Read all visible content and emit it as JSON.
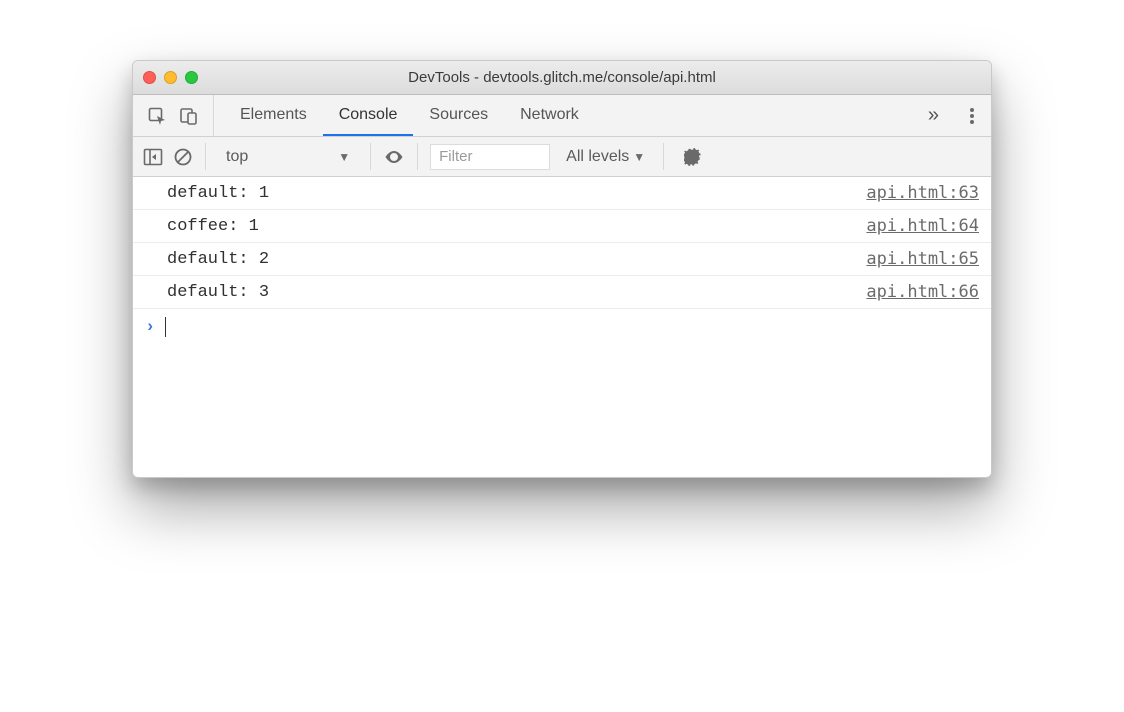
{
  "window": {
    "title": "DevTools - devtools.glitch.me/console/api.html"
  },
  "panelTabs": {
    "items": [
      "Elements",
      "Console",
      "Sources",
      "Network"
    ],
    "activeIndex": 1,
    "overflowGlyph": "»"
  },
  "consoleToolbar": {
    "context": "top",
    "filterPlaceholder": "Filter",
    "filterValue": "",
    "levelsLabel": "All levels"
  },
  "consoleRows": [
    {
      "message": "default: 1",
      "source": "api.html:63"
    },
    {
      "message": "coffee: 1",
      "source": "api.html:64"
    },
    {
      "message": "default: 2",
      "source": "api.html:65"
    },
    {
      "message": "default: 3",
      "source": "api.html:66"
    }
  ],
  "prompt": {
    "chevron": "›"
  }
}
